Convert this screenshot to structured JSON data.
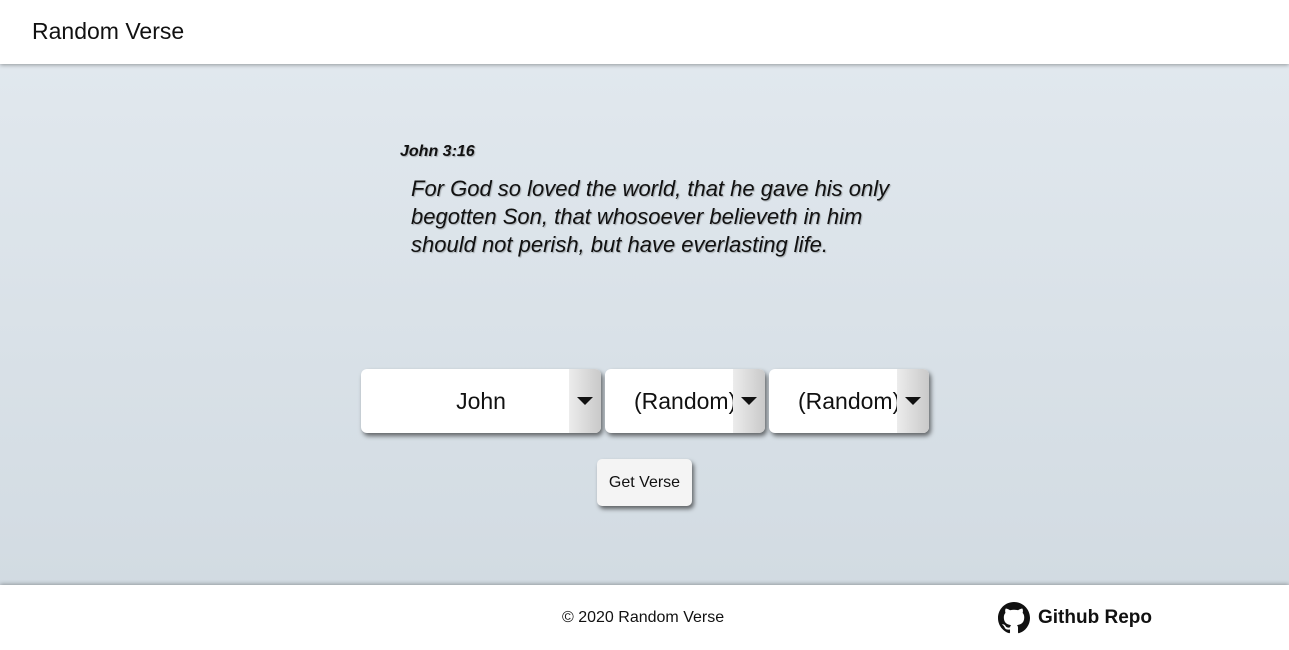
{
  "header": {
    "title": "Random Verse"
  },
  "verse": {
    "reference": "John 3:16",
    "text": "For God so loved the world, that he gave his only begotten Son, that whosoever believeth in him should not perish, but have everlasting life."
  },
  "selectors": {
    "book": "John",
    "chapter": "(Random)",
    "verse": "(Random)"
  },
  "actions": {
    "get_verse_label": "Get Verse"
  },
  "footer": {
    "copyright": "© 2020 Random Verse",
    "repo_label": "Github Repo",
    "repo_icon": "github-icon"
  }
}
